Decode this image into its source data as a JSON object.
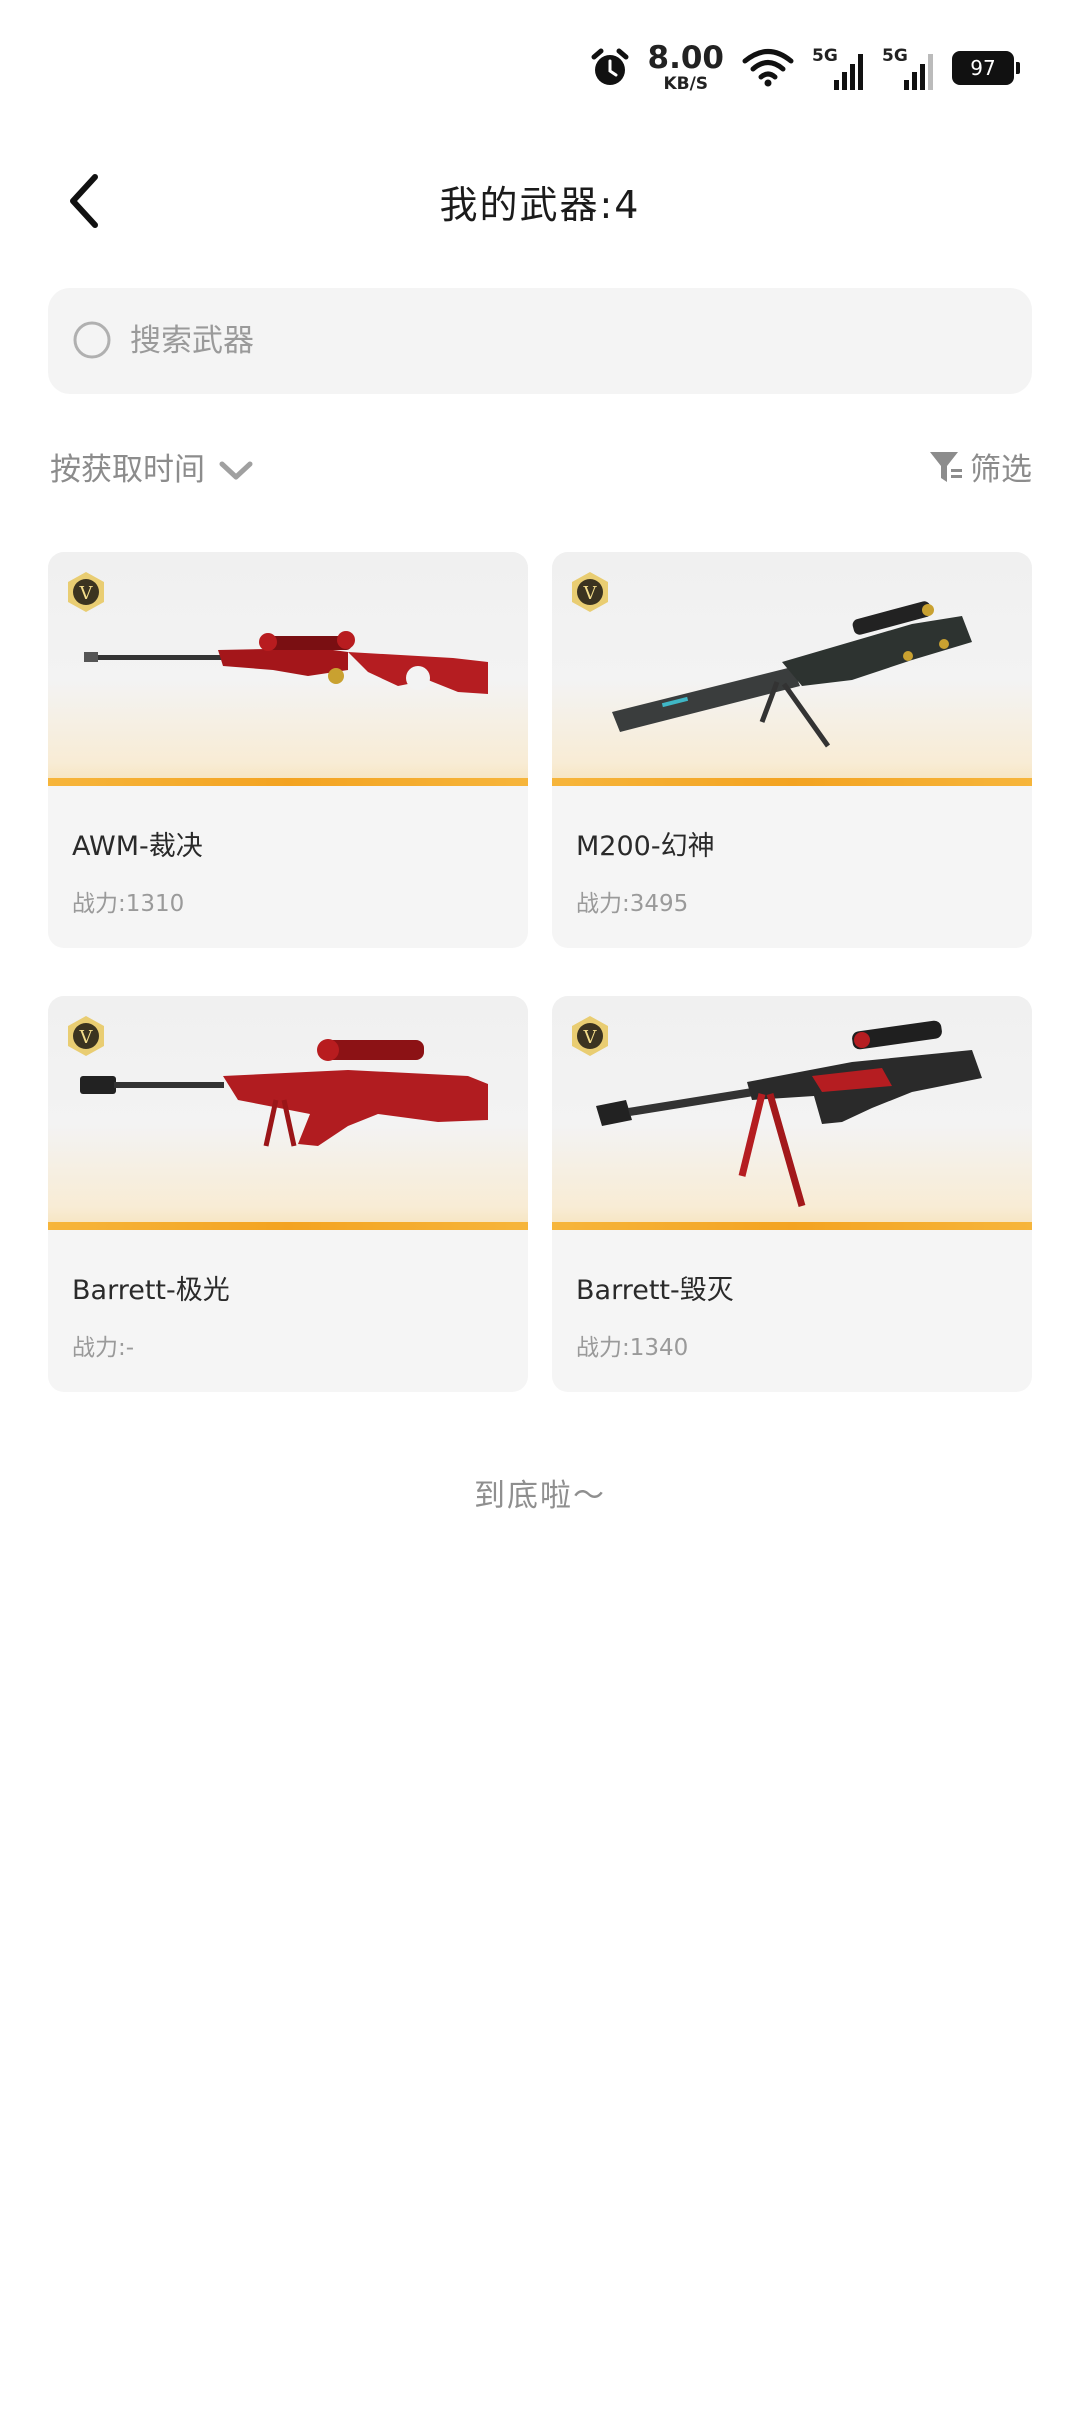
{
  "status_bar": {
    "speed_value": "8.00",
    "speed_unit": "KB/S",
    "net1_label": "5G",
    "net2_label": "5G",
    "battery": "97",
    "icons": [
      "alarm-icon",
      "wifi-icon",
      "signal-icon",
      "signal-icon",
      "battery-icon"
    ]
  },
  "header": {
    "title": "我的武器:4"
  },
  "search": {
    "placeholder": "搜索武器"
  },
  "toolbar": {
    "sort_label": "按获取时间",
    "filter_label": "筛选"
  },
  "weapons": [
    {
      "name": "AWM-裁决",
      "power": "战力:1310",
      "badge": "V"
    },
    {
      "name": "M200-幻神",
      "power": "战力:3495",
      "badge": "V"
    },
    {
      "name": "Barrett-极光",
      "power": "战力:-",
      "badge": "V"
    },
    {
      "name": "Barrett-毁灭",
      "power": "战力:1340",
      "badge": "V"
    }
  ],
  "footer": {
    "end_text": "到底啦～"
  },
  "colors": {
    "accent_orange": "#f3a321",
    "badge_gold": "#d8b34a",
    "card_bg": "#f5f5f5"
  }
}
